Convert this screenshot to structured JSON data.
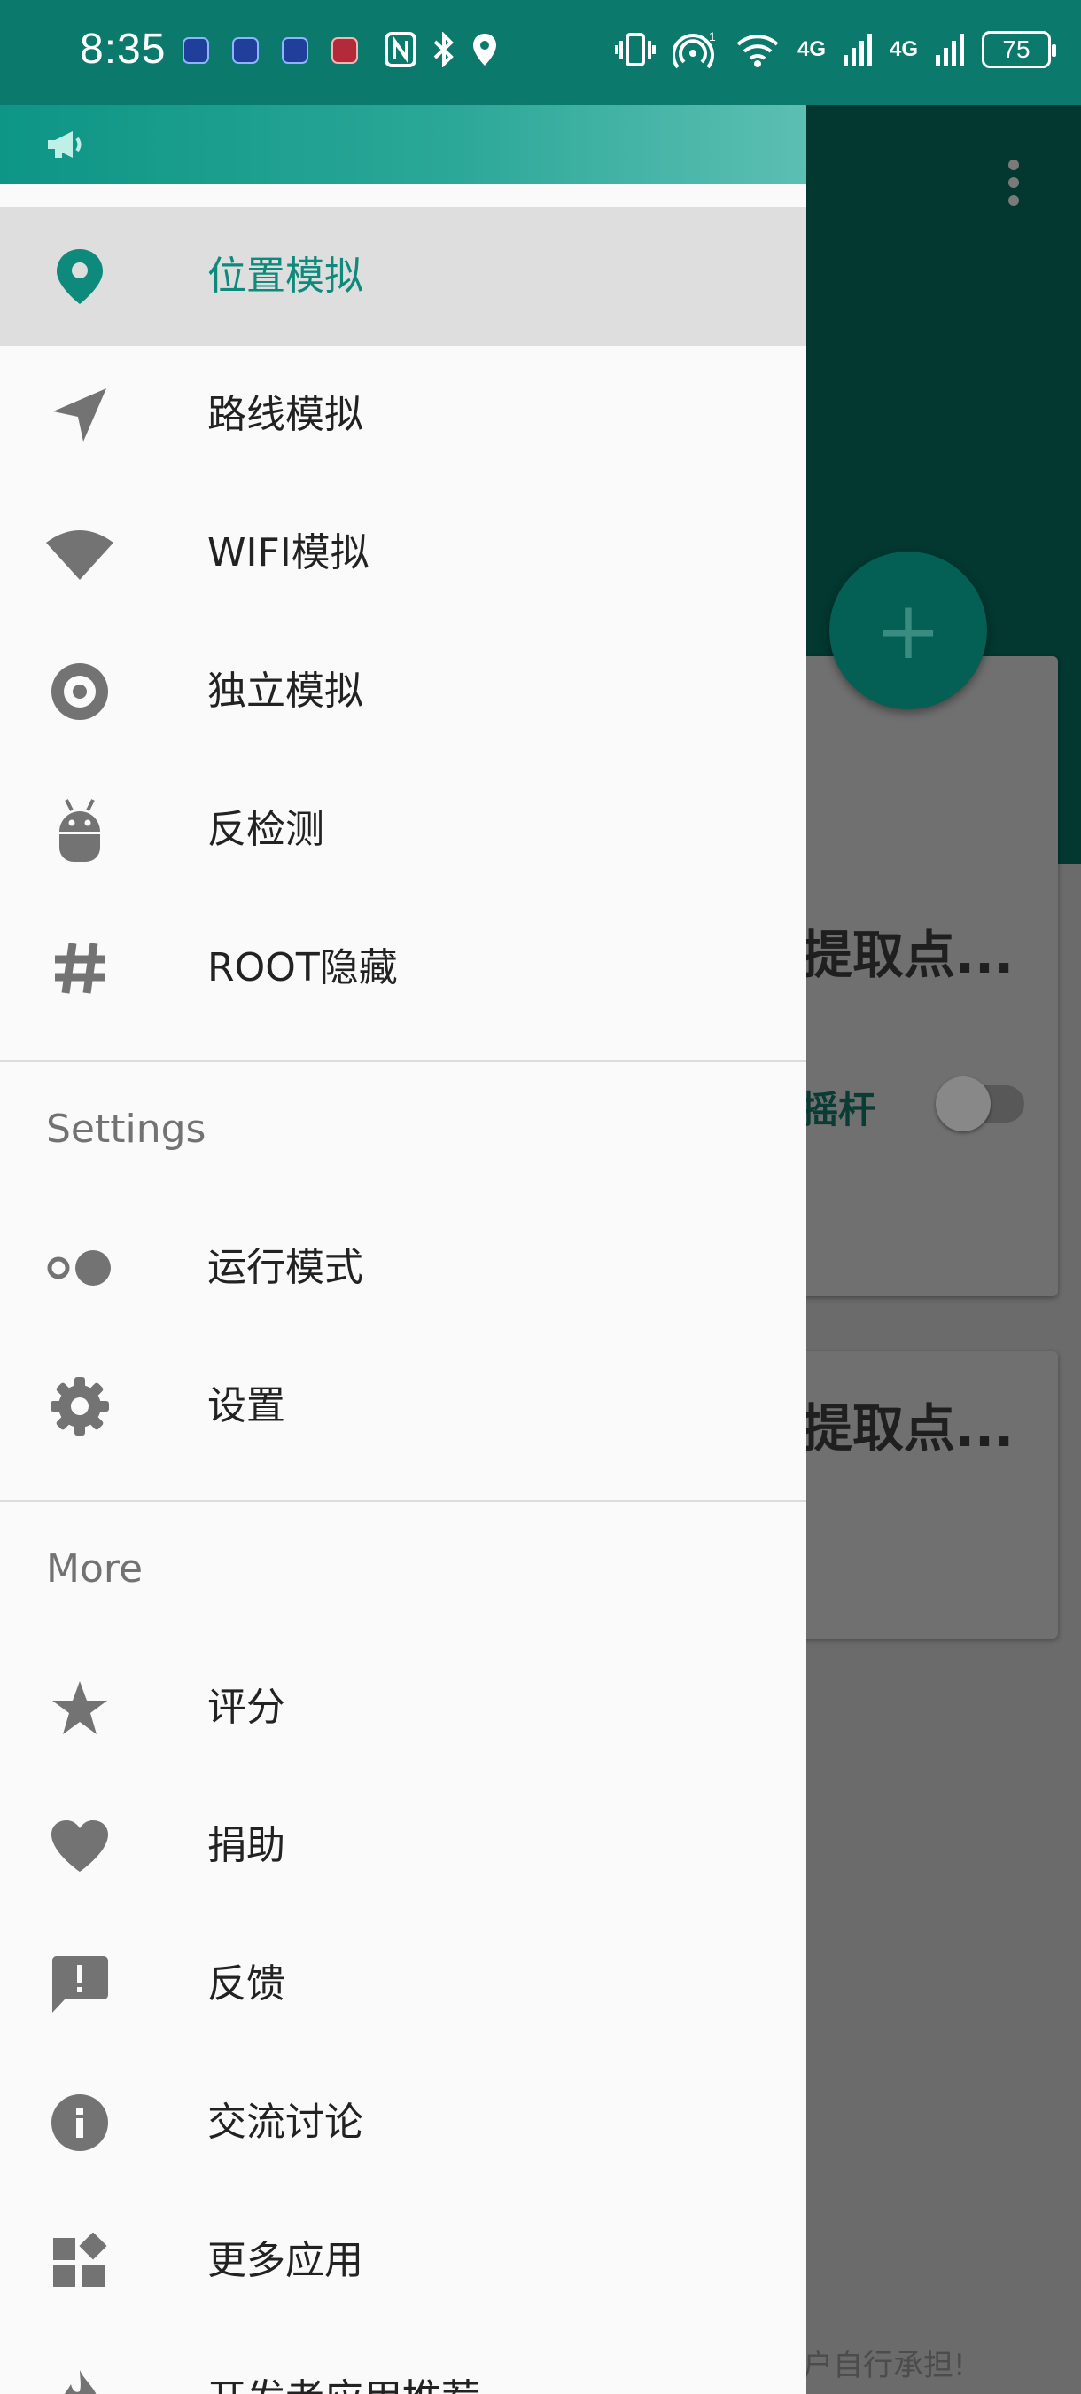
{
  "status_bar": {
    "time": "8:35",
    "network_badge_1": "4G",
    "network_badge_2": "4G",
    "battery": "75"
  },
  "background_app": {
    "card1_title": "提取点...",
    "card1_joystick_label": "摇杆",
    "card2_title": "提取点...",
    "fab_label": "+",
    "footer_text": "户自行承担!"
  },
  "drawer": {
    "nav_items": [
      {
        "label": "位置模拟",
        "icon": "location-pin-icon",
        "active": true
      },
      {
        "label": "路线模拟",
        "icon": "navigation-arrow-icon"
      },
      {
        "label": "WIFI模拟",
        "icon": "wifi-icon"
      },
      {
        "label": "独立模拟",
        "icon": "disc-icon"
      },
      {
        "label": "反检测",
        "icon": "android-icon"
      },
      {
        "label": "ROOT隐藏",
        "icon": "hash-icon"
      }
    ],
    "settings_section": {
      "title": "Settings",
      "items": [
        {
          "label": "运行模式",
          "icon": "toggle-dots-icon"
        },
        {
          "label": "设置",
          "icon": "gear-icon"
        }
      ]
    },
    "more_section": {
      "title": "More",
      "items": [
        {
          "label": "评分",
          "icon": "star-icon"
        },
        {
          "label": "捐助",
          "icon": "heart-icon"
        },
        {
          "label": "反馈",
          "icon": "feedback-icon"
        },
        {
          "label": "交流讨论",
          "icon": "info-icon"
        },
        {
          "label": "更多应用",
          "icon": "widgets-icon"
        },
        {
          "label": "开发者应用推荐",
          "icon": "fire-icon"
        }
      ]
    }
  },
  "colors": {
    "accent": "#0e8a7c",
    "status_bar": "#0b7a6c",
    "icon_gray": "#737373"
  }
}
